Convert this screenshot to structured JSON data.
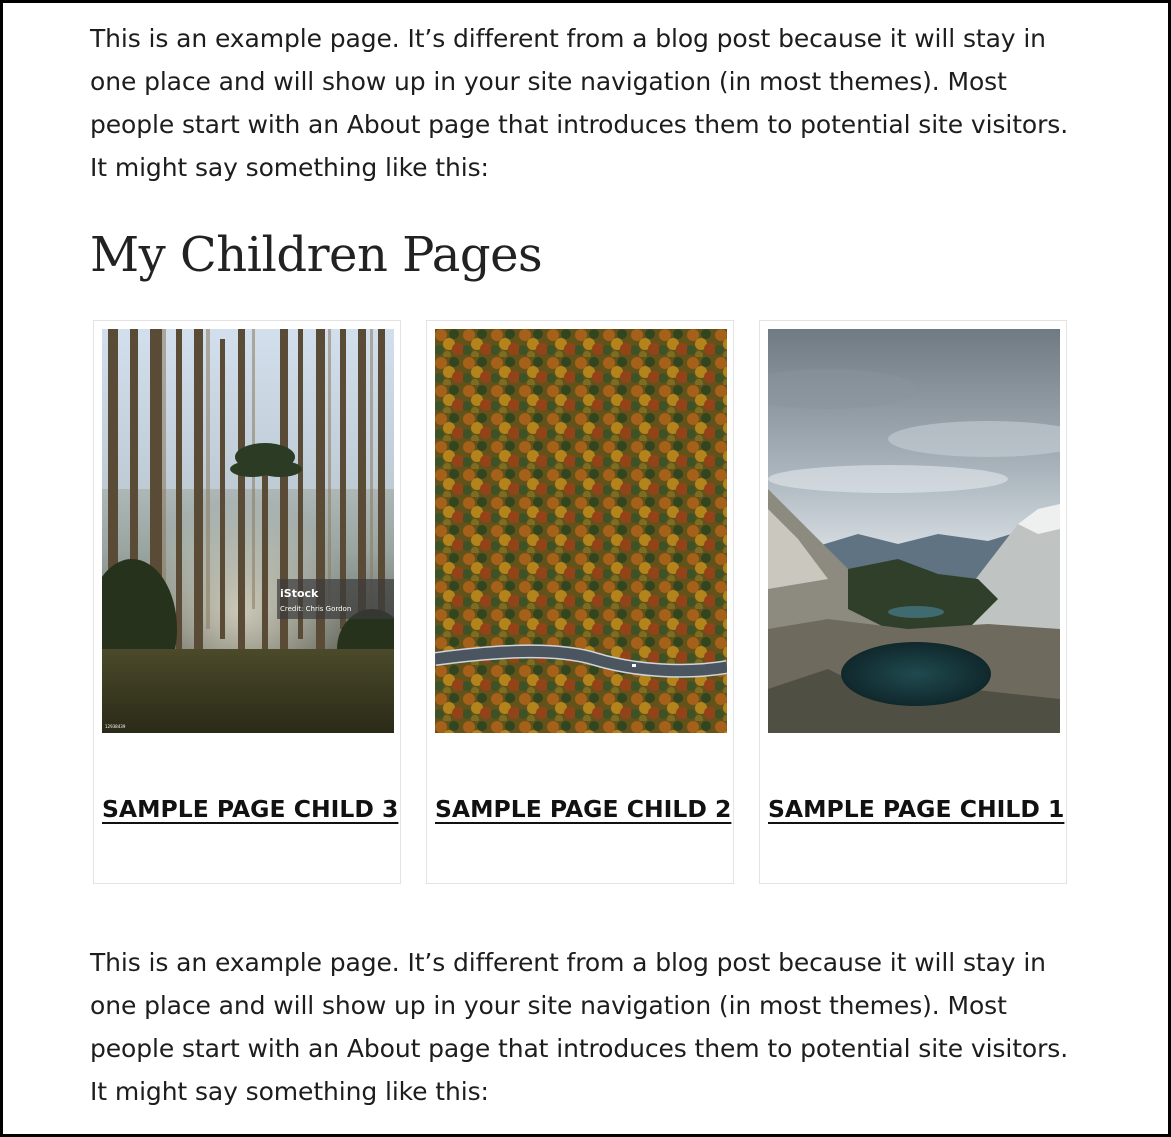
{
  "content": {
    "intro_top": "This is an example page. It’s different from a blog post because it will stay in one place and will show up in your site navigation (in most themes). Most people start with an About page that introduces them to potential site visitors. It might say something like this:",
    "section_title": "My Children Pages",
    "cards": [
      {
        "title": "SAMPLE PAGE CHILD 3",
        "image": "forest-with-tall-trees-photo",
        "watermark_brand": "iStock",
        "watermark_credit": "Credit: Chris Gordon",
        "watermark_id": "12938439"
      },
      {
        "title": "SAMPLE PAGE CHILD 2",
        "image": "aerial-autumn-forest-road-photo"
      },
      {
        "title": "SAMPLE PAGE CHILD 1",
        "image": "alpine-lake-mountains-photo"
      }
    ],
    "intro_bottom": "This is an example page. It’s different from a blog post because it will stay in one place and will show up in your site navigation (in most themes). Most people start with an About page that introduces them to potential site visitors. It might say something like this:"
  },
  "colors": {
    "text": "#1d1d1d",
    "border": "#000000",
    "card_border": "#e3e3e3"
  }
}
